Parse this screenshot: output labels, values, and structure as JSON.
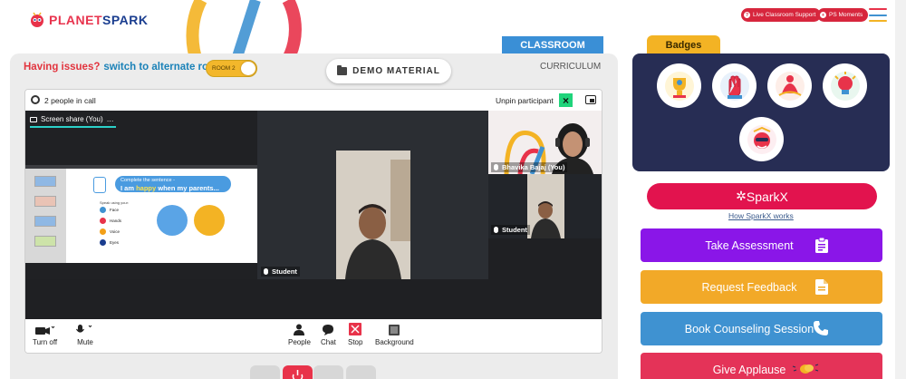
{
  "header": {
    "logo_text_a": "PLANET",
    "logo_text_b": "SPARK",
    "live_support_label": "Live Classroom Support",
    "ps_moments_label": "PS Moments",
    "menu_colors": [
      "#e8334a",
      "#3f92d1",
      "#f3b324"
    ]
  },
  "tabs": {
    "classroom": "CLASSROOM",
    "curriculum": "CURRICULUM"
  },
  "issues": {
    "question": "Having issues?",
    "link": "switch to alternate room",
    "toggle_label": "ROOM 2"
  },
  "demo_material_label": "DEMO MATERIAL",
  "meet": {
    "people_count": "2 people in call",
    "unpin_label": "Unpin participant",
    "screen_share_label": "Screen share (You)",
    "more": "…",
    "slide": {
      "prompt": "Complete the sentence -",
      "sentence_a": "I am ",
      "sentence_hl": "happy",
      "sentence_b": " when my parents...",
      "speak_label": "Speak using your:",
      "items": [
        "Face",
        "Hands",
        "Voice",
        "Eyes"
      ]
    },
    "participants": {
      "main": "Student",
      "teacher": "Bhavika Bajaj (You)",
      "small": "Student"
    },
    "controls": {
      "turn_off": "Turn off",
      "mute": "Mute",
      "people": "People",
      "chat": "Chat",
      "stop": "Stop",
      "background": "Background"
    }
  },
  "right": {
    "badges_title": "Badges",
    "sparkx_label": "SparkX",
    "how_link": "How SparkX works",
    "actions": {
      "assessment": "Take Assessment",
      "feedback": "Request Feedback",
      "counseling": "Book Counseling Session",
      "applause": "Give Applause"
    }
  },
  "colors": {
    "brand_red": "#e2134e",
    "brand_blue": "#3f92d1",
    "brand_yellow": "#f3b324",
    "badges_bg": "#272d54",
    "assessment": "#8a16e8"
  }
}
